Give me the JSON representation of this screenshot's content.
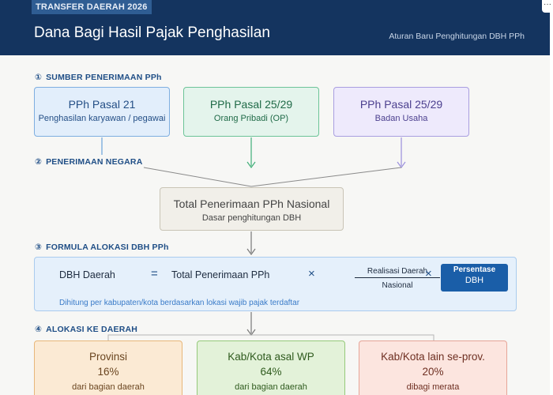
{
  "header": {
    "badge": "TRANSFER DAERAH 2026",
    "title": "Dana Bagi Hasil Pajak Penghasilan",
    "subtitle": "Aturan Baru Penghitungan DBH PPh",
    "corner_glyph": "···"
  },
  "sections": {
    "s1": {
      "num": "①",
      "label": "SUMBER PENERIMAAN PPh"
    },
    "s2": {
      "num": "②",
      "label": "PENERIMAAN NEGARA"
    },
    "s3": {
      "num": "③",
      "label": "FORMULA ALOKASI DBH PPh"
    },
    "s4": {
      "num": "④",
      "label": "ALOKASI KE DAERAH"
    }
  },
  "sources": [
    {
      "title": "PPh Pasal 21",
      "subtitle": "Penghasilan karyawan / pegawai"
    },
    {
      "title": "PPh Pasal 25/29",
      "subtitle": "Orang Pribadi (OP)"
    },
    {
      "title": "PPh Pasal 25/29",
      "subtitle": "Badan Usaha"
    }
  ],
  "total": {
    "title": "Total Penerimaan PPh Nasional",
    "subtitle": "Dasar penghitungan DBH"
  },
  "formula": {
    "lhs": "DBH Daerah",
    "eq": "=",
    "term1": "Total Penerimaan PPh",
    "times": "×",
    "numerator": "Realisasi Daerah",
    "denominator": "Nasional",
    "pct_line1": "Persentase",
    "pct_line2": "DBH",
    "note": "Dihitung per kabupaten/kota berdasarkan lokasi wajib pajak terdaftar"
  },
  "allocations": [
    {
      "title": "Provinsi",
      "percent": "16%",
      "note": "dari bagian daerah"
    },
    {
      "title": "Kab/Kota asal WP",
      "percent": "64%",
      "note": "dari bagian daerah"
    },
    {
      "title": "Kab/Kota lain se-prov.",
      "percent": "20%",
      "note": "dibagi merata"
    }
  ],
  "colors": {
    "header_bg": "#14345f",
    "accent": "#1f4e86",
    "source1_line": "#6aa3da",
    "source2_line": "#3fae77",
    "source3_line": "#9a8fdc",
    "flow_line": "#777777"
  }
}
